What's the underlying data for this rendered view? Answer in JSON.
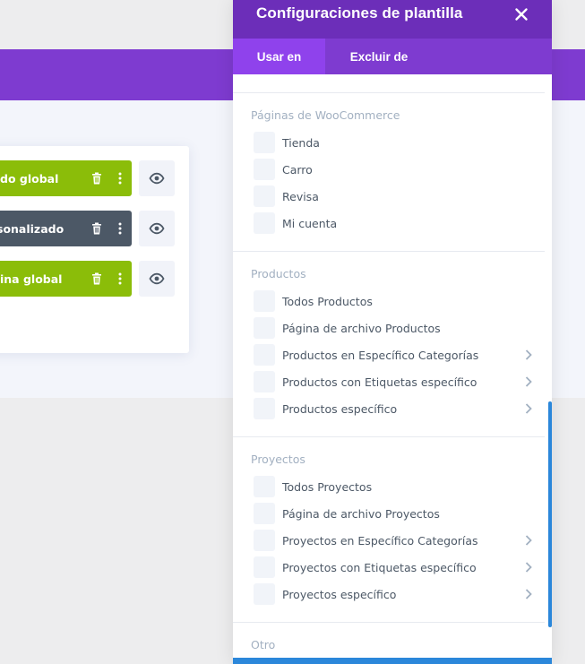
{
  "builder": {
    "templates": [
      {
        "label": "do global",
        "color": "#8bbd09"
      },
      {
        "label": "sonalizado",
        "color": "#4c5866"
      },
      {
        "label": "ina global",
        "color": "#8bbd09"
      }
    ]
  },
  "modal": {
    "title": "Configuraciones de plantilla",
    "close_icon": "close-icon",
    "tabs": [
      {
        "label": "Usar en",
        "active": true
      },
      {
        "label": "Excluir de",
        "active": false
      }
    ],
    "sections": [
      {
        "title": "Páginas de WooCommerce",
        "options": [
          {
            "label": "Tienda",
            "has_chevron": false
          },
          {
            "label": "Carro",
            "has_chevron": false
          },
          {
            "label": "Revisa",
            "has_chevron": false
          },
          {
            "label": "Mi cuenta",
            "has_chevron": false
          }
        ]
      },
      {
        "title": "Productos",
        "options": [
          {
            "label": "Todos Productos",
            "has_chevron": false
          },
          {
            "label": "Página de archivo Productos",
            "has_chevron": false
          },
          {
            "label": "Productos en Específico Categorías",
            "has_chevron": true
          },
          {
            "label": "Productos con Etiquetas específico",
            "has_chevron": true
          },
          {
            "label": "Productos específico",
            "has_chevron": true
          }
        ]
      },
      {
        "title": "Proyectos",
        "options": [
          {
            "label": "Todos Proyectos",
            "has_chevron": false
          },
          {
            "label": "Página de archivo Proyectos",
            "has_chevron": false
          },
          {
            "label": "Proyectos en Específico Categorías",
            "has_chevron": true
          },
          {
            "label": "Proyectos con Etiquetas específico",
            "has_chevron": true
          },
          {
            "label": "Proyectos específico",
            "has_chevron": true
          }
        ]
      },
      {
        "title": "Otro",
        "options": []
      }
    ]
  },
  "colors": {
    "purple_dark": "#6c2eb9",
    "purple": "#7e3bd0",
    "purple_active_tab": "#8f42ec",
    "green": "#8bbd09",
    "slate": "#4c5866",
    "blue_accent": "#2b87da"
  }
}
